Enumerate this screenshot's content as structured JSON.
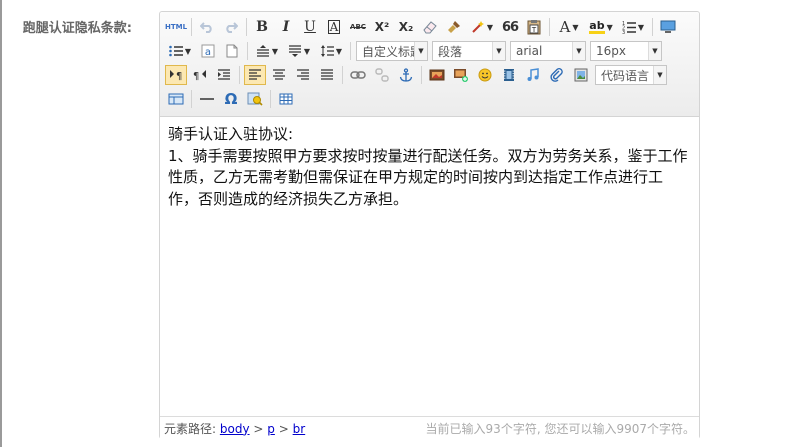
{
  "form": {
    "field_label": "跑腿认证隐私条款:"
  },
  "toolbar": {
    "source_label": "HTML",
    "bold": "B",
    "italic": "I",
    "underline": "U",
    "fontborder": "A",
    "strike": "ABC",
    "superscript": "X²",
    "subscript": "X₂",
    "blockquote": "66",
    "forecolor": "A",
    "backcolor": "ab",
    "custom_heading": "自定义标题",
    "paragraph": "段落",
    "font_family": "arial",
    "font_size": "16px",
    "omega": "Ω",
    "code_language": "代码语言"
  },
  "content": {
    "paragraphs": [
      "骑手认证入驻协议:",
      "1、骑手需要按照甲方要求按时按量进行配送任务。双方为劳务关系，鉴于工作性质，乙方无需考勤但需保证在甲方规定的时间按内到达指定工作点进行工作，否则造成的经济损失乙方承担。"
    ]
  },
  "statusbar": {
    "path_label": "元素路径:",
    "path": [
      "body",
      "p",
      "br"
    ],
    "sep": ">",
    "count_text": "当前已输入93个字符, 您还可以输入9907个字符。"
  }
}
